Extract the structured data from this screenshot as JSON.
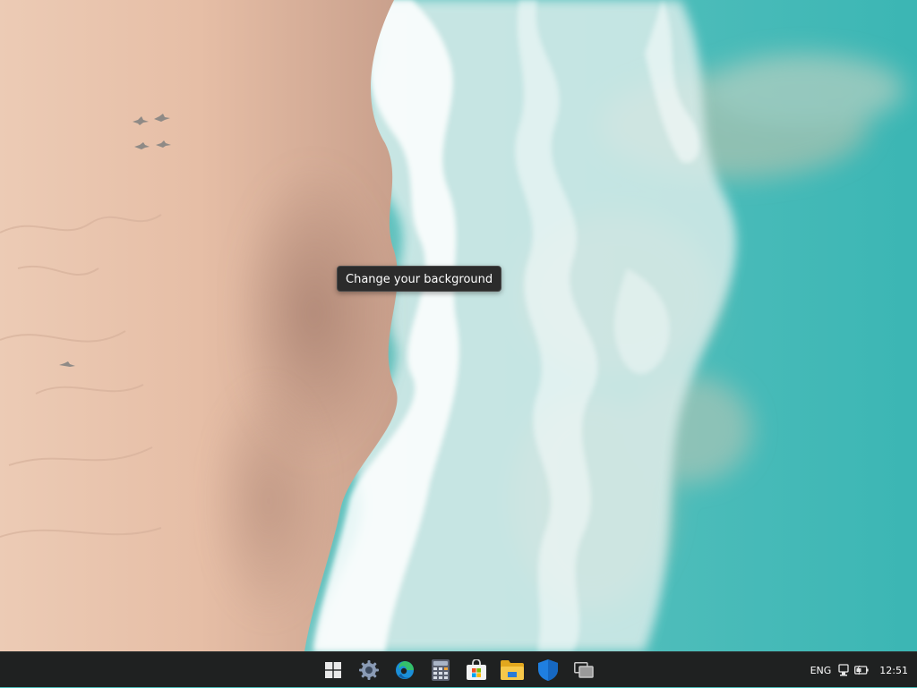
{
  "desktop": {
    "tooltip": "Change your background"
  },
  "taskbar": {
    "apps": [
      {
        "name": "start",
        "icon": "windows-logo-icon"
      },
      {
        "name": "settings",
        "icon": "gear-icon"
      },
      {
        "name": "edge",
        "icon": "edge-browser-icon"
      },
      {
        "name": "calculator",
        "icon": "calculator-icon"
      },
      {
        "name": "store",
        "icon": "store-bag-icon"
      },
      {
        "name": "file-explorer",
        "icon": "folder-icon"
      },
      {
        "name": "security",
        "icon": "shield-icon"
      },
      {
        "name": "task-view",
        "icon": "task-view-icon"
      }
    ],
    "tray": {
      "language": "ENG",
      "network_icon": "network-icon",
      "battery_icon": "battery-icon",
      "clock": "12:51"
    }
  }
}
